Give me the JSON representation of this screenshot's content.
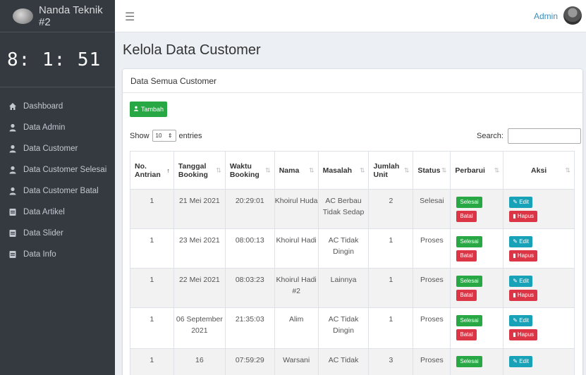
{
  "brand": {
    "name": "Nanda Teknik #2"
  },
  "clock": "8: 1: 51",
  "sidebar": {
    "items": [
      {
        "label": "Dashboard",
        "icon": "home-icon"
      },
      {
        "label": "Data Admin",
        "icon": "user-icon"
      },
      {
        "label": "Data Customer",
        "icon": "user-icon"
      },
      {
        "label": "Data Customer Selesai",
        "icon": "user-icon"
      },
      {
        "label": "Data Customer Batal",
        "icon": "user-icon"
      },
      {
        "label": "Data Artikel",
        "icon": "document-icon"
      },
      {
        "label": "Data Slider",
        "icon": "document-icon"
      },
      {
        "label": "Data Info",
        "icon": "document-icon"
      }
    ]
  },
  "topbar": {
    "menu_icon": "☰",
    "user": "Admin"
  },
  "page": {
    "title": "Kelola Data Customer"
  },
  "card": {
    "title": "Data Semua Customer",
    "add_label": "Tambah",
    "show_label": "Show",
    "entries_value": "10",
    "entries_label": "entries",
    "search_label": "Search:",
    "search_value": ""
  },
  "table": {
    "columns": [
      {
        "label": "No. Antrian",
        "sort": "↑"
      },
      {
        "label": "Tanggal Booking",
        "sort": "⇅"
      },
      {
        "label": "Waktu Booking",
        "sort": "⇅"
      },
      {
        "label": "Nama",
        "sort": "⇅"
      },
      {
        "label": "Masalah",
        "sort": "⇅"
      },
      {
        "label": "Jumlah Unit",
        "sort": "⇅"
      },
      {
        "label": "Status",
        "sort": "⇅"
      },
      {
        "label": "Perbarui",
        "sort": "⇅"
      },
      {
        "label": "Aksi",
        "sort": "⇅"
      }
    ],
    "rows": [
      {
        "no": "1",
        "tanggal": "21 Mei 2021",
        "waktu": "20:29:01",
        "nama": "Khoirul Huda",
        "masalah": "AC Berbau Tidak Sedap",
        "jumlah": "2",
        "status": "Selesai"
      },
      {
        "no": "1",
        "tanggal": "23 Mei 2021",
        "waktu": "08:00:13",
        "nama": "Khoirul Hadi",
        "masalah": "AC Tidak Dingin",
        "jumlah": "1",
        "status": "Proses"
      },
      {
        "no": "1",
        "tanggal": "22 Mei 2021",
        "waktu": "08:03:23",
        "nama": "Khoirul Hadi #2",
        "masalah": "Lainnya",
        "jumlah": "1",
        "status": "Proses"
      },
      {
        "no": "1",
        "tanggal": "06 September 2021",
        "waktu": "21:35:03",
        "nama": "Alim",
        "masalah": "AC Tidak Dingin",
        "jumlah": "1",
        "status": "Proses"
      },
      {
        "no": "1",
        "tanggal": "16",
        "waktu": "07:59:29",
        "nama": "Warsani",
        "masalah": "AC Tidak",
        "jumlah": "3",
        "status": "Proses"
      }
    ],
    "selesai_label": "Selesai",
    "batal_label": "Batal",
    "edit_label": "Edit",
    "hapus_label": "Hapus"
  },
  "colors": {
    "sidebar": "#343a40",
    "green": "#28a745",
    "red": "#dc3545",
    "teal": "#17a2b8",
    "link": "#3c8dbc"
  }
}
